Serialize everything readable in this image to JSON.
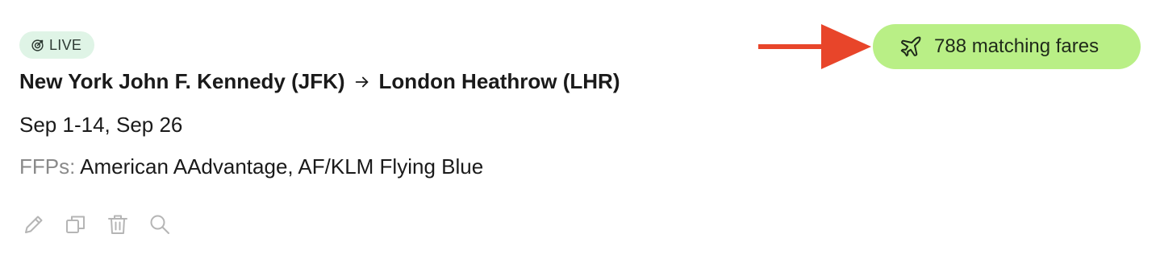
{
  "status": {
    "label": "LIVE",
    "icon": "target-icon",
    "color": "#dff4e6"
  },
  "route": {
    "origin": "New York John F. Kennedy (JFK)",
    "arrow": "arrow-right-icon",
    "destination": "London Heathrow (LHR)"
  },
  "dates": "Sep 1-14, Sep 26",
  "ffps": {
    "label": "FFPs:",
    "value": "American AAdvantage, AF/KLM Flying Blue"
  },
  "actions": [
    {
      "name": "edit",
      "icon": "pencil-icon"
    },
    {
      "name": "duplicate",
      "icon": "copy-icon"
    },
    {
      "name": "delete",
      "icon": "trash-icon"
    },
    {
      "name": "search",
      "icon": "search-icon"
    }
  ],
  "fares": {
    "label": "788 matching fares",
    "icon": "plane-icon",
    "background": "#b9ef86"
  },
  "annotation": {
    "icon": "red-arrow-icon",
    "color": "#e8452a"
  }
}
